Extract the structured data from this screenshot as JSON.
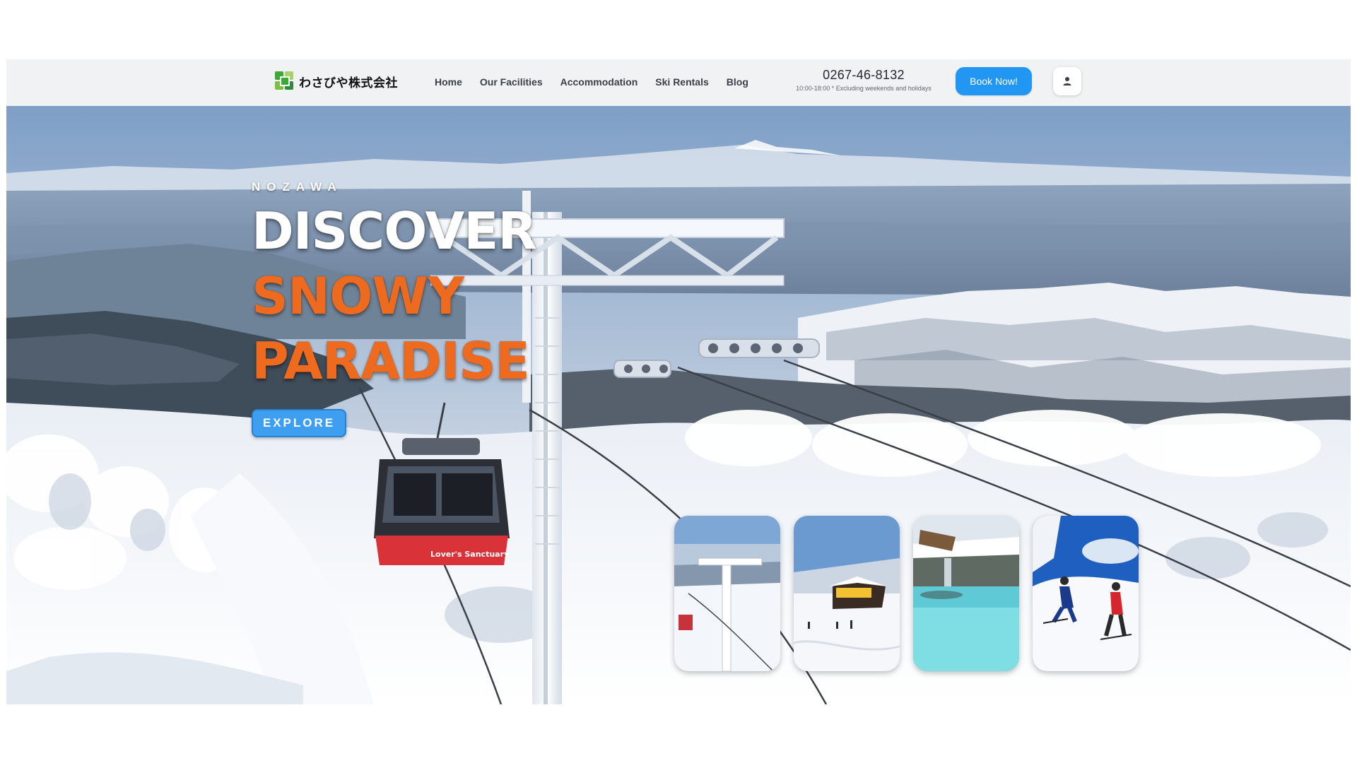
{
  "brand": {
    "name": "わさびや株式会社",
    "colors": [
      "#3aa935",
      "#7bc043",
      "#2e8b3a",
      "#a5d36a"
    ]
  },
  "nav": {
    "items": [
      {
        "label": "Home"
      },
      {
        "label": "Our Facilities"
      },
      {
        "label": "Accommodation"
      },
      {
        "label": "Ski Rentals"
      },
      {
        "label": "Blog"
      }
    ]
  },
  "contact": {
    "phone": "0267-46-8132",
    "hours": "10:00-18:00 * Excluding weekends and holidays"
  },
  "header": {
    "book_label": "Book Now!",
    "user_icon": "user-icon",
    "accent": "#2196f3"
  },
  "hero": {
    "kicker": "NOZAWA",
    "line1": "DISCOVER",
    "line2": "SNOWY",
    "line3": "PARADISE",
    "explore_label": "EXPLORE",
    "accent_orange": "#ee6a1e",
    "gondola_sign": "Lover's Sanctuary"
  },
  "cards": [
    {
      "name": "lift-tower-card"
    },
    {
      "name": "ski-lodge-card"
    },
    {
      "name": "hot-spring-card"
    },
    {
      "name": "skiers-card"
    }
  ]
}
